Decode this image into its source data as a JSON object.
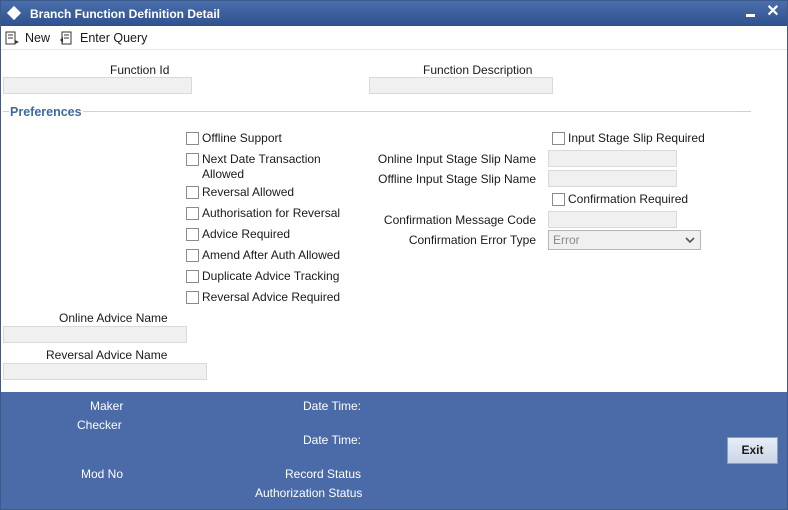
{
  "window": {
    "title": "Branch Function Definition Detail"
  },
  "toolbar": {
    "new_label": "New",
    "enter_query_label": "Enter Query"
  },
  "header": {
    "function_id_label": "Function Id",
    "function_id_value": "",
    "function_description_label": "Function Description",
    "function_description_value": ""
  },
  "preferences": {
    "section_title": "Preferences",
    "checkboxes_left": [
      {
        "label": "Offline Support",
        "checked": false
      },
      {
        "label": "Next Date Transaction Allowed",
        "checked": false
      },
      {
        "label": "Reversal Allowed",
        "checked": false
      },
      {
        "label": "Authorisation for Reversal",
        "checked": false
      },
      {
        "label": "Advice Required",
        "checked": false
      },
      {
        "label": "Amend After Auth Allowed",
        "checked": false
      },
      {
        "label": "Duplicate Advice Tracking",
        "checked": false
      },
      {
        "label": "Reversal Advice Required",
        "checked": false
      }
    ],
    "input_stage_slip_required": {
      "label": "Input Stage Slip Required",
      "checked": false
    },
    "online_input_stage_slip_name_label": "Online Input Stage Slip Name",
    "online_input_stage_slip_name_value": "",
    "offline_input_stage_slip_name_label": "Offline Input Stage Slip Name",
    "offline_input_stage_slip_name_value": "",
    "confirmation_required": {
      "label": "Confirmation Required",
      "checked": false
    },
    "confirmation_message_code_label": "Confirmation Message Code",
    "confirmation_message_code_value": "",
    "confirmation_error_type_label": "Confirmation Error Type",
    "confirmation_error_type_value": "Error",
    "online_advice_name_label": "Online Advice Name",
    "online_advice_name_value": "",
    "reversal_advice_name_label": "Reversal Advice Name",
    "reversal_advice_name_value": ""
  },
  "footer": {
    "maker_label": "Maker",
    "checker_label": "Checker",
    "date_time_label_1": "Date Time:",
    "date_time_label_2": "Date Time:",
    "mod_no_label": "Mod No",
    "record_status_label": "Record Status",
    "authorization_status_label": "Authorization Status",
    "exit_label": "Exit"
  },
  "colors": {
    "titlebar": "#2f528e",
    "footer": "#4a6aa8",
    "section_title": "#3d6aa0"
  },
  "icons": {
    "new": "new-document-icon",
    "enter_query": "query-icon",
    "title": "diamond-icon",
    "minimize": "minimize-icon",
    "close": "close-icon"
  }
}
